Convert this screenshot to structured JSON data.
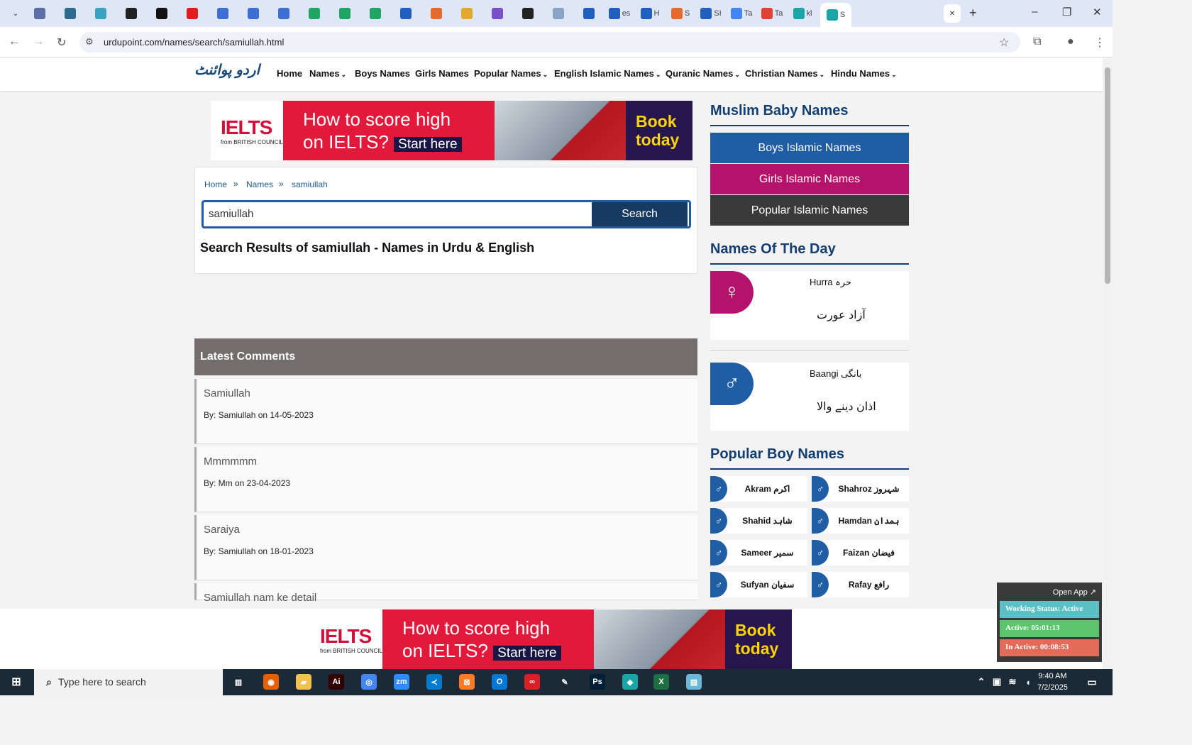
{
  "browser": {
    "tabs": [
      {
        "label": ""
      },
      {
        "label": ""
      },
      {
        "label": ""
      },
      {
        "label": ""
      },
      {
        "label": ""
      },
      {
        "label": ""
      },
      {
        "label": ""
      },
      {
        "label": ""
      },
      {
        "label": ""
      },
      {
        "label": ""
      },
      {
        "label": ""
      },
      {
        "label": ""
      },
      {
        "label": ""
      },
      {
        "label": ""
      },
      {
        "label": ""
      },
      {
        "label": ""
      },
      {
        "label": ""
      },
      {
        "label": ""
      },
      {
        "label": ""
      },
      {
        "label": "es"
      },
      {
        "label": "H"
      },
      {
        "label": "S"
      },
      {
        "label": "SI"
      },
      {
        "label": "Ta"
      },
      {
        "label": "Ta"
      },
      {
        "label": "kl"
      },
      {
        "label": "S"
      }
    ],
    "url": "urdupoint.com/names/search/samiullah.html"
  },
  "site": {
    "logo_text": "اردو پوائنٹ",
    "menu": [
      "Home",
      "Names",
      "Boys Names",
      "Girls Names",
      "Popular Names",
      "English Islamic Names",
      "Quranic Names",
      "Christian Names",
      "Hindu Names"
    ]
  },
  "ad": {
    "brand": "IELTS",
    "from": "from BRITISH COUNCIL",
    "line1": "How to score high",
    "line2": "on IELTS?",
    "cta": "Start here",
    "book1": "Book",
    "book2": "today"
  },
  "breadcrumb": [
    "Home",
    "Names",
    "samiullah"
  ],
  "search": {
    "value": "samiullah",
    "button": "Search"
  },
  "results_title": "Search Results of samiullah - Names in Urdu & English",
  "comments": {
    "title": "Latest Comments",
    "items": [
      {
        "title": "Samiullah",
        "by": "By: Samiullah on 14-05-2023"
      },
      {
        "title": "Mmmmmm",
        "by": "By: Mm on 23-04-2023"
      },
      {
        "title": "Saraiya",
        "by": "By: Samiullah on 18-01-2023"
      },
      {
        "title": "Samiullah nam ke detail",
        "by": ""
      }
    ]
  },
  "sidebar": {
    "muslim_title": "Muslim Baby Names",
    "buttons": [
      "Boys Islamic Names",
      "Girls Islamic Names",
      "Popular Islamic Names"
    ],
    "button_colors": [
      "#1f5da5",
      "#b5126b",
      "#3a3a3a"
    ],
    "nod_title": "Names Of The Day",
    "nod": [
      {
        "en": "Hurra حرہ",
        "ur": "آزاد عورت",
        "color": "#b5126b"
      },
      {
        "en": "Baangi بانگی",
        "ur": "اذان دینے والا",
        "color": "#1f5da5"
      }
    ],
    "popular_title": "Popular Boy Names",
    "popular": [
      "Akram اکرم",
      "Shahroz شہروز",
      "Shahid شاہد",
      "Hamdan ہمدان",
      "Sameer سمیر",
      "Faizan فیضان",
      "Sufyan سفیان",
      "Rafay رافع"
    ]
  },
  "widget": {
    "open": "Open App ↗",
    "status": "Working Status: Active",
    "active": "Active: 05:01:13",
    "inactive": "In Active: 00:08:53"
  },
  "taskbar": {
    "search_placeholder": "Type here to search",
    "time": "9:40 AM",
    "date": "7/2/2025"
  }
}
